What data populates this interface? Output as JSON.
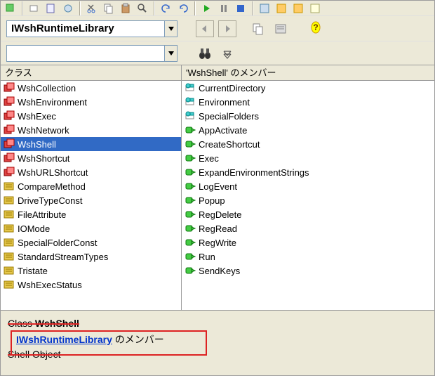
{
  "library_selected": "IWshRuntimeLibrary",
  "search_value": "",
  "classes_label": "クラス",
  "members_label_prefix": "'WshShell' のメンバー",
  "classes": [
    {
      "name": "WshCollection",
      "kind": "class"
    },
    {
      "name": "WshEnvironment",
      "kind": "class"
    },
    {
      "name": "WshExec",
      "kind": "class"
    },
    {
      "name": "WshNetwork",
      "kind": "class"
    },
    {
      "name": "WshShell",
      "kind": "class",
      "selected": true
    },
    {
      "name": "WshShortcut",
      "kind": "class"
    },
    {
      "name": "WshURLShortcut",
      "kind": "class"
    },
    {
      "name": "CompareMethod",
      "kind": "enum"
    },
    {
      "name": "DriveTypeConst",
      "kind": "enum"
    },
    {
      "name": "FileAttribute",
      "kind": "enum"
    },
    {
      "name": "IOMode",
      "kind": "enum"
    },
    {
      "name": "SpecialFolderConst",
      "kind": "enum"
    },
    {
      "name": "StandardStreamTypes",
      "kind": "enum"
    },
    {
      "name": "Tristate",
      "kind": "enum"
    },
    {
      "name": "WshExecStatus",
      "kind": "enum"
    }
  ],
  "members": [
    {
      "name": "CurrentDirectory",
      "kind": "property"
    },
    {
      "name": "Environment",
      "kind": "property"
    },
    {
      "name": "SpecialFolders",
      "kind": "property"
    },
    {
      "name": "AppActivate",
      "kind": "method"
    },
    {
      "name": "CreateShortcut",
      "kind": "method"
    },
    {
      "name": "Exec",
      "kind": "method"
    },
    {
      "name": "ExpandEnvironmentStrings",
      "kind": "method"
    },
    {
      "name": "LogEvent",
      "kind": "method"
    },
    {
      "name": "Popup",
      "kind": "method"
    },
    {
      "name": "RegDelete",
      "kind": "method"
    },
    {
      "name": "RegRead",
      "kind": "method"
    },
    {
      "name": "RegWrite",
      "kind": "method"
    },
    {
      "name": "Run",
      "kind": "method"
    },
    {
      "name": "SendKeys",
      "kind": "method"
    }
  ],
  "detail": {
    "class_label": "Class",
    "class_name": "WshShell",
    "link_text": "IWshRuntimeLibrary",
    "member_suffix": " のメンバー",
    "desc": "Shell Object"
  }
}
